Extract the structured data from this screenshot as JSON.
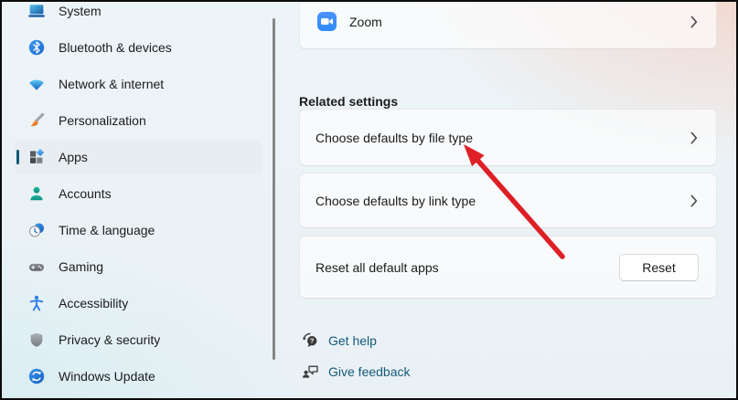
{
  "sidebar": {
    "items": [
      {
        "label": "System"
      },
      {
        "label": "Bluetooth & devices"
      },
      {
        "label": "Network & internet"
      },
      {
        "label": "Personalization"
      },
      {
        "label": "Apps",
        "selected": true
      },
      {
        "label": "Accounts"
      },
      {
        "label": "Time & language"
      },
      {
        "label": "Gaming"
      },
      {
        "label": "Accessibility"
      },
      {
        "label": "Privacy & security"
      },
      {
        "label": "Windows Update"
      }
    ]
  },
  "main": {
    "app_row": {
      "label": "Zoom"
    },
    "section_header": "Related settings",
    "rows": [
      {
        "label": "Choose defaults by file type"
      },
      {
        "label": "Choose defaults by link type"
      },
      {
        "label": "Reset all default apps",
        "button_label": "Reset"
      }
    ],
    "footer_links": [
      {
        "label": "Get help"
      },
      {
        "label": "Give feedback"
      }
    ]
  },
  "annotation": {
    "arrow_color": "#de1f26",
    "points_to": "Choose defaults by file type"
  },
  "colors": {
    "accent_pill": "#11597a",
    "link": "#17597a",
    "selected_item_bg": "#e7edf1",
    "scrollbar": "#878787"
  }
}
